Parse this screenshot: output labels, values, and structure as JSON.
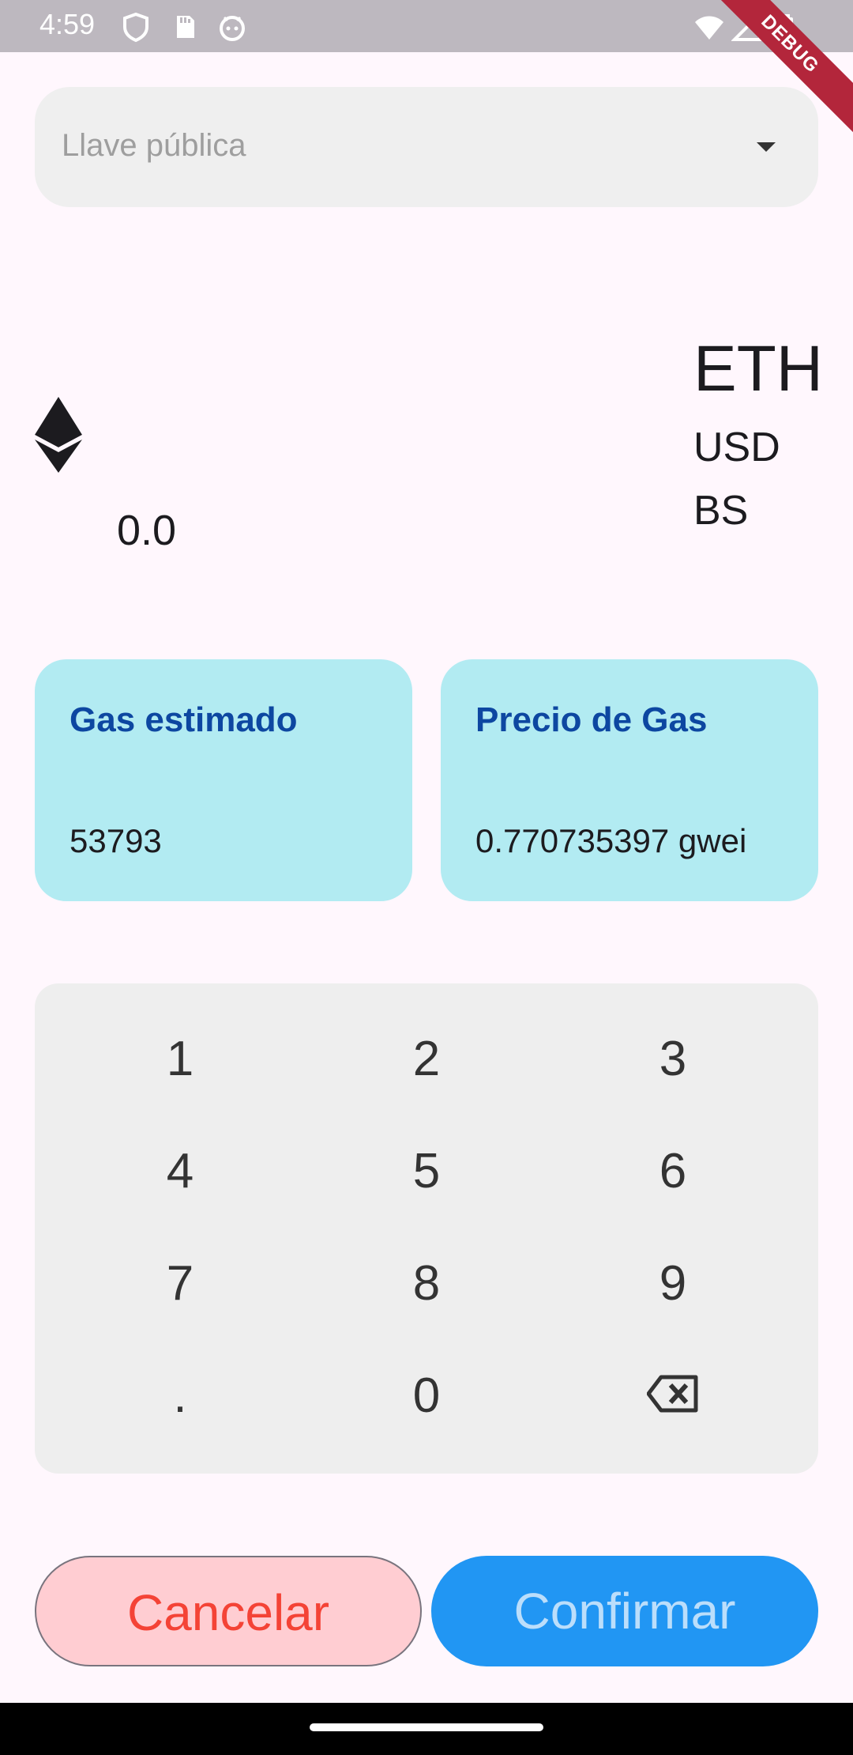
{
  "status_bar": {
    "time": "4:59",
    "icons_left": [
      "shield-icon",
      "sd-card-icon",
      "android-head-icon"
    ],
    "icons_right": [
      "wifi-icon",
      "cell-signal-icon",
      "battery-icon"
    ],
    "debug_banner": "DEBUG"
  },
  "form": {
    "public_key_placeholder": "Llave pública"
  },
  "amount": {
    "value": "0.0",
    "currencies": [
      "ETH",
      "USD",
      "BS"
    ],
    "selected_currency": "ETH"
  },
  "gas": {
    "estimated_label": "Gas estimado",
    "estimated_value": "53793",
    "price_label": "Precio de Gas",
    "price_value": "0.770735397 gwei"
  },
  "keypad": {
    "keys": [
      "1",
      "2",
      "3",
      "4",
      "5",
      "6",
      "7",
      "8",
      "9",
      ".",
      "0",
      "backspace"
    ]
  },
  "actions": {
    "cancel_label": "Cancelar",
    "confirm_label": "Confirmar"
  },
  "colors": {
    "background": "#FFF7FD",
    "card": "#B2EBF2",
    "card_title": "#0D47A1",
    "cancel_bg": "#FFCDD2",
    "cancel_text": "#F44336",
    "confirm_bg": "#2196F3",
    "confirm_text": "#BBDEFB"
  }
}
